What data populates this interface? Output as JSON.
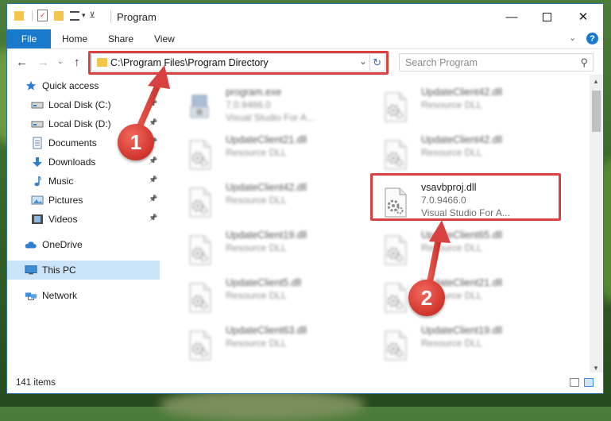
{
  "window": {
    "title": "Program"
  },
  "ribbon": {
    "tabs": [
      "File",
      "Home",
      "Share",
      "View"
    ],
    "help": "?"
  },
  "nav": {
    "address": "C:\\Program Files\\Program Directory",
    "search_placeholder": "Search Program"
  },
  "sidebar": {
    "items": [
      {
        "label": "Quick access",
        "icon": "star-icon"
      },
      {
        "label": "Local Disk (C:)",
        "icon": "drive-icon",
        "pinned": true
      },
      {
        "label": "Local Disk (D:)",
        "icon": "drive-icon",
        "pinned": true
      },
      {
        "label": "Documents",
        "icon": "documents-icon",
        "pinned": true
      },
      {
        "label": "Downloads",
        "icon": "downloads-icon",
        "pinned": true
      },
      {
        "label": "Music",
        "icon": "music-icon",
        "pinned": true
      },
      {
        "label": "Pictures",
        "icon": "pictures-icon",
        "pinned": true
      },
      {
        "label": "Videos",
        "icon": "videos-icon",
        "pinned": true
      },
      {
        "label": "OneDrive",
        "icon": "cloud-icon"
      },
      {
        "label": "This PC",
        "icon": "computer-icon",
        "selected": true
      },
      {
        "label": "Network",
        "icon": "network-icon"
      }
    ]
  },
  "files": {
    "left": [
      {
        "name": "program.exe",
        "line2": "7.0.9466.0",
        "line3": "Visual Studio For A..."
      },
      {
        "name": "UpdateClient21.dll",
        "line2": "Resource DLL"
      },
      {
        "name": "UpdateClient42.dll",
        "line2": "Resource DLL"
      },
      {
        "name": "UpdateClient19.dll",
        "line2": "Resource DLL"
      },
      {
        "name": "UpdateClient5.dll",
        "line2": "Resource DLL"
      },
      {
        "name": "UpdateClient63.dll",
        "line2": "Resource DLL"
      }
    ],
    "right": [
      {
        "name": "UpdateClient42.dll",
        "line2": "Resource DLL"
      },
      {
        "name": "UpdateClient42.dll",
        "line2": "Resource DLL"
      },
      {
        "name": "vsavbproj.dll",
        "line2": "7.0.9466.0",
        "line3": "Visual Studio For A...",
        "highlight": true
      },
      {
        "name": "UpdateClient65.dll",
        "line2": "Resource DLL"
      },
      {
        "name": "UpdateClient21.dll",
        "line2": "Resource DLL"
      },
      {
        "name": "UpdateClient19.dll",
        "line2": "Resource DLL"
      }
    ]
  },
  "status": {
    "count": "141 items"
  },
  "annotations": {
    "step1": "1",
    "step2": "2",
    "color": "#d94040"
  }
}
